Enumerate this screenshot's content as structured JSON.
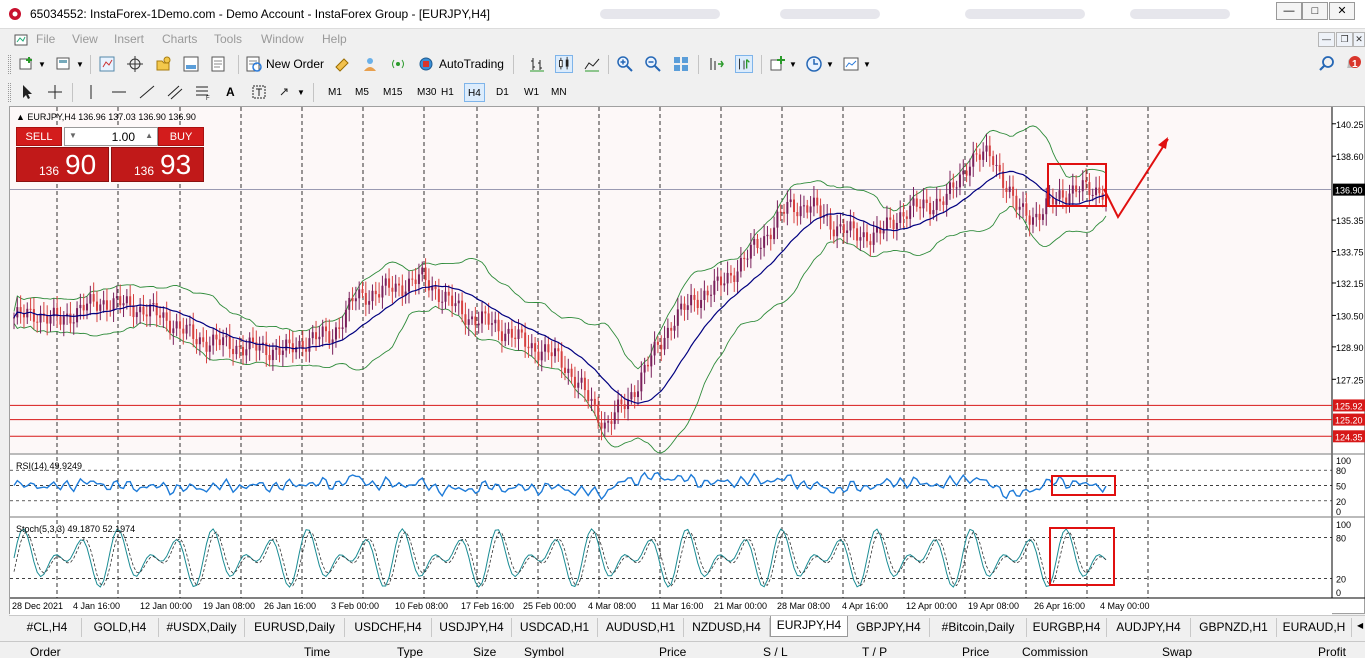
{
  "window": {
    "title": "65034552: InstaForex-1Demo.com - Demo Account - InstaForex Group - [EURJPY,H4]"
  },
  "menu": [
    "File",
    "View",
    "Insert",
    "Charts",
    "Tools",
    "Window",
    "Help"
  ],
  "toolbar": {
    "new_order": "New Order",
    "auto_trading": "AutoTrading",
    "notification_count": "1"
  },
  "timeframes": [
    "M1",
    "M5",
    "M15",
    "M30",
    "H1",
    "H4",
    "D1",
    "W1",
    "MN"
  ],
  "active_timeframe": "H4",
  "chart": {
    "info": "EURJPY,H4  136.96 137.03 136.90 136.90",
    "trade_panel": {
      "sell_label": "SELL",
      "buy_label": "BUY",
      "lot": "1.00",
      "sell_small": "136",
      "sell_big": "90",
      "buy_small": "136",
      "buy_big": "93"
    },
    "price_axis": [
      "140.25",
      "138.60",
      "136.90",
      "135.35",
      "133.75",
      "132.15",
      "130.50",
      "128.90",
      "127.25",
      "125.92",
      "125.20",
      "124.35"
    ],
    "current_price": "136.90",
    "red_level_labels": [
      "125.92",
      "125.20",
      "124.35"
    ],
    "rsi_label": "RSI(14) 49.9249",
    "rsi_axis": [
      "100",
      "80",
      "50",
      "20",
      "0"
    ],
    "stoch_label": "Stoch(5,3,3) 49.1870 52.1974",
    "stoch_axis": [
      "100",
      "80",
      "20",
      "0"
    ],
    "time_axis": [
      "28 Dec 2021",
      "4 Jan 16:00",
      "12 Jan 00:00",
      "19 Jan 08:00",
      "26 Jan 16:00",
      "3 Feb 00:00",
      "10 Feb 08:00",
      "17 Feb 16:00",
      "25 Feb 00:00",
      "4 Mar 08:00",
      "11 Mar 16:00",
      "21 Mar 00:00",
      "28 Mar 08:00",
      "4 Apr 16:00",
      "12 Apr 00:00",
      "19 Apr 08:00",
      "26 Apr 16:00",
      "4 May 00:00"
    ]
  },
  "chart_data": {
    "type": "line",
    "symbol": "EURJPY",
    "timeframe": "H4",
    "ylim": [
      123.5,
      140.9
    ],
    "close": [
      130.4,
      130.6,
      130.2,
      130.9,
      131.2,
      131.0,
      130.7,
      130.1,
      129.3,
      129.1,
      128.9,
      128.8,
      128.7,
      129.3,
      129.5,
      131.4,
      131.7,
      132.0,
      132.4,
      131.3,
      130.4,
      130.1,
      129.4,
      128.8,
      128.3,
      126.7,
      124.9,
      126.2,
      128.3,
      130.3,
      131.4,
      132.0,
      133.2,
      134.5,
      136.0,
      136.1,
      135.1,
      134.6,
      134.6,
      135.7,
      136.1,
      136.4,
      138.4,
      138.7,
      136.0,
      135.5,
      136.7,
      136.9,
      136.9
    ],
    "rsi_ylim": [
      0,
      100
    ],
    "stoch_ylim": [
      0,
      100
    ]
  },
  "symbol_tabs": [
    "#CL,H4",
    "GOLD,H4",
    "#USDX,Daily",
    "EURUSD,Daily",
    "USDCHF,H4",
    "USDJPY,H4",
    "USDCAD,H1",
    "AUDUSD,H1",
    "NZDUSD,H4",
    "EURJPY,H4",
    "GBPJPY,H4",
    "#Bitcoin,Daily",
    "EURGBP,H4",
    "AUDJPY,H4",
    "GBPNZD,H1",
    "EURAUD,H"
  ],
  "active_tab": "EURJPY,H4",
  "orders_header": [
    "Order",
    "Time",
    "Type",
    "Size",
    "Symbol",
    "Price",
    "S / L",
    "T / P",
    "Price",
    "Commission",
    "Swap",
    "Profit"
  ]
}
